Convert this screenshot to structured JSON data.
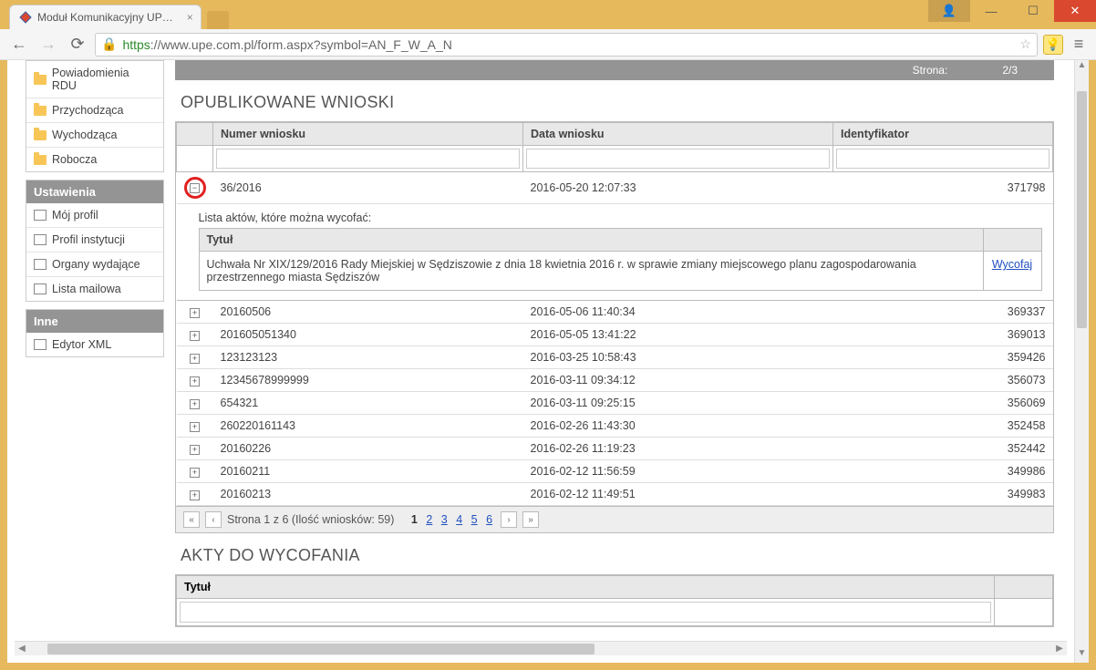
{
  "browser": {
    "tab_title": "Moduł Komunikacyjny UP…",
    "url_scheme": "https",
    "url_rest": "://www.upe.com.pl/form.aspx?symbol=AN_F_W_A_N"
  },
  "header_strip": {
    "label_strona": "Strona:",
    "page_value": "2/3"
  },
  "sidebar": {
    "folders": [
      {
        "label": "Powiadomienia RDU"
      },
      {
        "label": "Przychodząca"
      },
      {
        "label": "Wychodząca"
      },
      {
        "label": "Robocza"
      }
    ],
    "settings_header": "Ustawienia",
    "settings_items": [
      {
        "label": "Mój profil"
      },
      {
        "label": "Profil instytucji"
      },
      {
        "label": "Organy wydające"
      },
      {
        "label": "Lista mailowa"
      }
    ],
    "other_header": "Inne",
    "other_items": [
      {
        "label": "Edytor XML"
      }
    ]
  },
  "section_published": {
    "title": "OPUBLIKOWANE WNIOSKI",
    "columns": {
      "c1": "Numer wniosku",
      "c2": "Data wniosku",
      "c3": "Identyfikator"
    },
    "expanded_row": {
      "numer": "36/2016",
      "data": "2016-05-20 12:07:33",
      "id": "371798"
    },
    "sub_label": "Lista aktów, które można wycofać:",
    "sub_columns": {
      "tytul": "Tytuł"
    },
    "sub_row": {
      "tytul": "Uchwała Nr XIX/129/2016 Rady Miejskiej w Sędziszowie z dnia 18 kwietnia 2016 r. w sprawie zmiany miejscowego planu zagospodarowania przestrzennego miasta Sędziszów",
      "action": "Wycofaj"
    },
    "rows": [
      {
        "numer": "20160506",
        "data": "2016-05-06 11:40:34",
        "id": "369337"
      },
      {
        "numer": "201605051340",
        "data": "2016-05-05 13:41:22",
        "id": "369013"
      },
      {
        "numer": "123123123",
        "data": "2016-03-25 10:58:43",
        "id": "359426"
      },
      {
        "numer": "12345678999999",
        "data": "2016-03-11 09:34:12",
        "id": "356073"
      },
      {
        "numer": "654321",
        "data": "2016-03-11 09:25:15",
        "id": "356069"
      },
      {
        "numer": "260220161143",
        "data": "2016-02-26 11:43:30",
        "id": "352458"
      },
      {
        "numer": "20160226",
        "data": "2016-02-26 11:19:23",
        "id": "352442"
      },
      {
        "numer": "20160211",
        "data": "2016-02-12 11:56:59",
        "id": "349986"
      },
      {
        "numer": "20160213",
        "data": "2016-02-12 11:49:51",
        "id": "349983"
      }
    ],
    "pager": {
      "text": "Strona 1 z 6 (Ilość wniosków: 59)",
      "pages": [
        "1",
        "2",
        "3",
        "4",
        "5",
        "6"
      ]
    }
  },
  "section_withdraw": {
    "title": "AKTY DO WYCOFANIA",
    "columns": {
      "tytul": "Tytuł"
    }
  }
}
